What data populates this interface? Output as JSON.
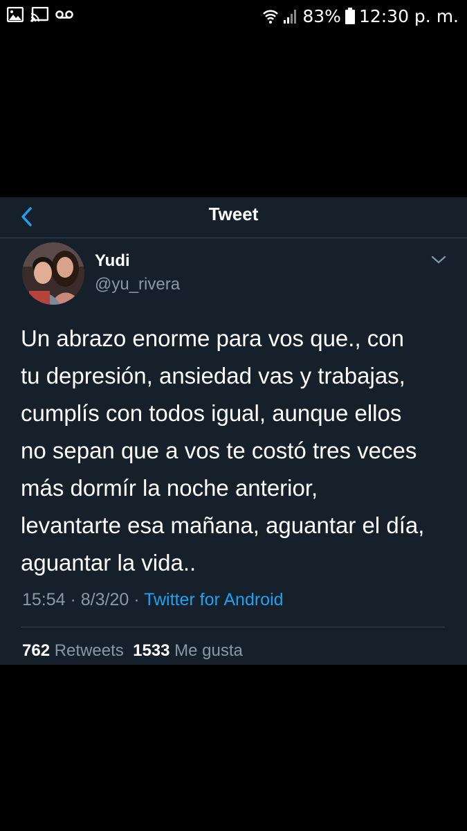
{
  "status_bar": {
    "battery": "83%",
    "time": "12:30 p. m.",
    "icons": [
      "image-icon",
      "cast-icon",
      "voicemail-icon",
      "wifi-icon",
      "signal-icon",
      "battery-icon"
    ]
  },
  "nav": {
    "title": "Tweet",
    "back_icon": "chevron-left-icon"
  },
  "tweet": {
    "author": {
      "display_name": "Yudi",
      "handle": "@yu_rivera"
    },
    "text_lines": [
      "Un abrazo enorme para vos que., con",
      "tu depresión, ansiedad vas y trabajas,",
      "cumplís con todos igual, aunque ellos",
      "no sepan que a vos te costó tres veces",
      "más dormír la noche anterior,",
      "levantarte esa mañana, aguantar el día,",
      "aguantar la vida.."
    ],
    "time": "15:54",
    "separator": " · ",
    "date": "8/3/20",
    "source": "Twitter for Android",
    "retweets": "762",
    "retweets_label": "Retweets",
    "likes": "1533",
    "likes_label": "Me gusta"
  },
  "colors": {
    "background": "#15202b",
    "accent": "#1da1f2",
    "secondary_text": "#8899a6",
    "divider": "#38444d"
  }
}
